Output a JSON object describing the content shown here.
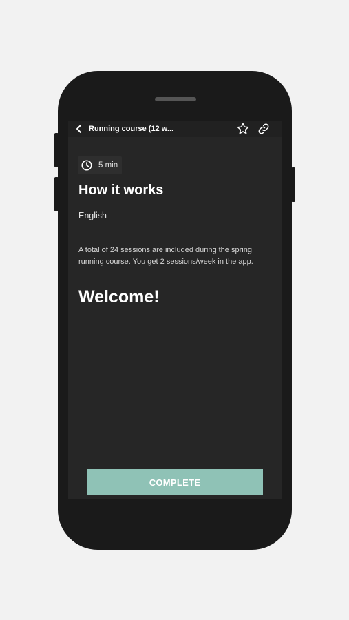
{
  "header": {
    "title": "Running course (12 w...",
    "back_icon": "chevron-left-icon",
    "favorite_icon": "star-icon",
    "share_icon": "link-icon"
  },
  "content": {
    "duration": "5 min",
    "duration_icon": "clock-icon",
    "title": "How it works",
    "language": "English",
    "description": "A total of 24 sessions are included during the spring running course. You get 2 sessions/week in the app.",
    "welcome": "Welcome!"
  },
  "footer": {
    "complete_label": "COMPLETE"
  },
  "colors": {
    "page_background": "#f2f2f2",
    "device_body": "#1a1a1a",
    "screen_background": "#262626",
    "accent": "#8fc2b6",
    "text_primary": "#ffffff"
  }
}
